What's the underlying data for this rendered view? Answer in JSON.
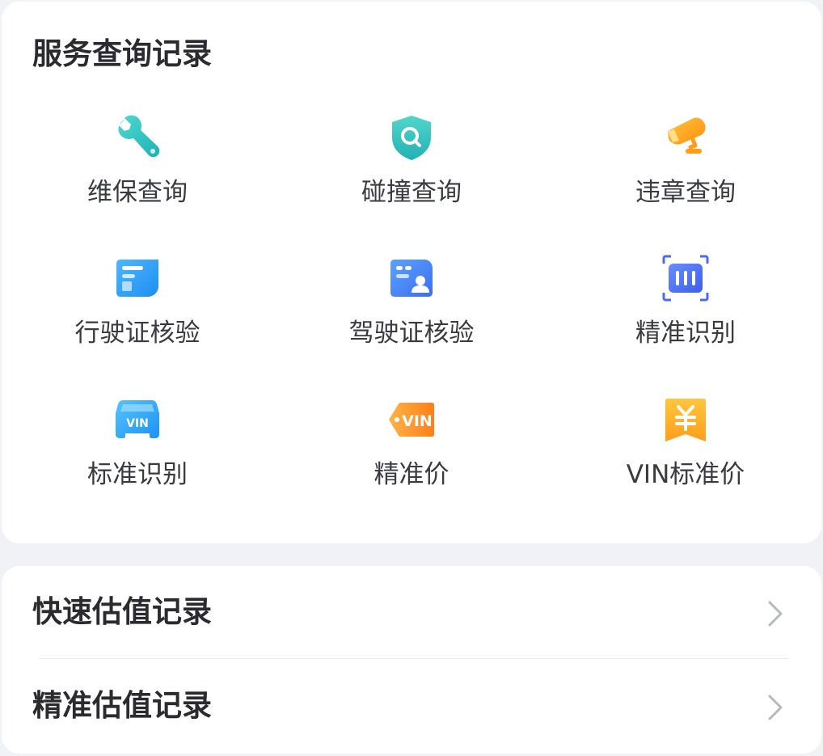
{
  "service_records": {
    "title": "服务查询记录",
    "items": [
      {
        "label": "维保查询",
        "icon": "wrench-icon"
      },
      {
        "label": "碰撞查询",
        "icon": "shield-search-icon"
      },
      {
        "label": "违章查询",
        "icon": "traffic-camera-icon"
      },
      {
        "label": "行驶证核验",
        "icon": "vehicle-license-card-icon"
      },
      {
        "label": "驾驶证核验",
        "icon": "driver-license-card-icon"
      },
      {
        "label": "精准识别",
        "icon": "scan-frame-icon"
      },
      {
        "label": "标准识别",
        "icon": "vin-car-icon"
      },
      {
        "label": "精准价",
        "icon": "vin-tag-icon"
      },
      {
        "label": "VIN标准价",
        "icon": "yuan-bookmark-icon"
      }
    ]
  },
  "valuation_records": {
    "items": [
      {
        "label": "快速估值记录",
        "icon": "chevron-right-icon"
      },
      {
        "label": "精准估值记录",
        "icon": "chevron-right-icon"
      }
    ]
  },
  "colors": {
    "background": "#f1f2f6",
    "card": "#ffffff",
    "title_text": "#2b2b2f",
    "label_text": "#3a3b40",
    "teal": "#2fc5bf",
    "orange": "#ff9c1a",
    "blue": "#3d8cf5",
    "indigo": "#4b6cf0",
    "chevron": "#b8b9be"
  }
}
